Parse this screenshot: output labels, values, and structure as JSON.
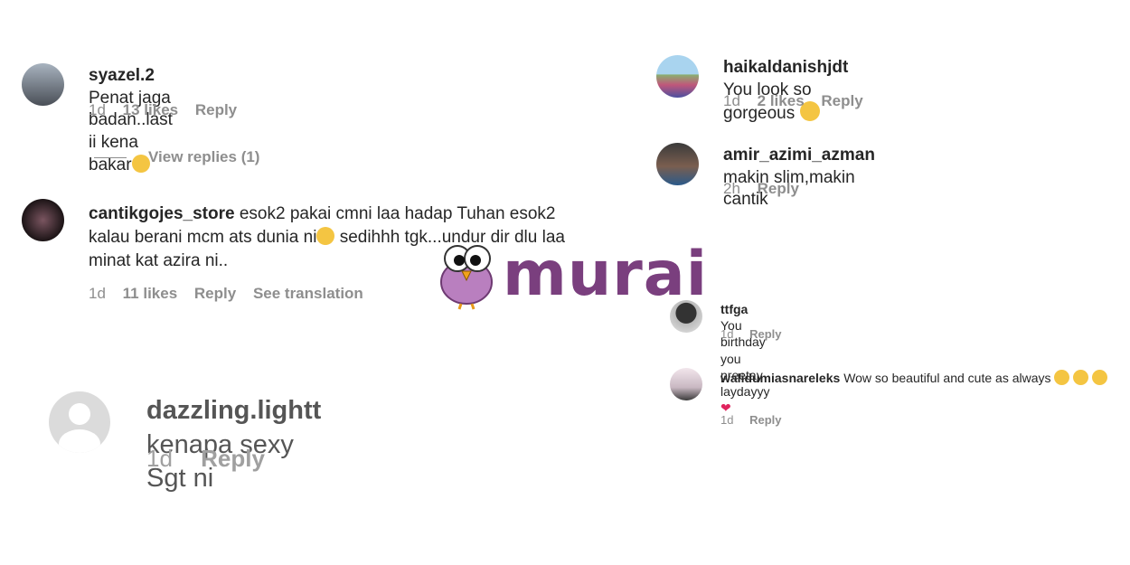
{
  "comments": [
    {
      "user": "syazel.2",
      "text": "Penat jaga badan..last ii kena bakar",
      "emoji": "sad-face-icon",
      "time": "1d",
      "likes": "13 likes",
      "reply": "Reply",
      "view_replies": "View replies (1)"
    },
    {
      "user": "cantikgojes_store",
      "text": "esok2 pakai cmni laa hadap Tuhan esok2 kalau berani mcm ats dunia ni",
      "text2": "sedihhh tgk...undur dir dlu laa minat kat azira ni..",
      "emoji": "sad-face-icon",
      "time": "1d",
      "likes": "11 likes",
      "reply": "Reply",
      "translate": "See translation"
    },
    {
      "user": "dazzling.lightt",
      "text": "kenapa sexy Sgt ni",
      "time": "1d",
      "reply": "Reply"
    },
    {
      "user": "haikaldanishjdt",
      "text": "You look so gorgeous",
      "emoji": "heart-eyes-icon",
      "time": "1d",
      "likes": "2 likes",
      "reply": "Reply"
    },
    {
      "user": "amir_azimi_azman",
      "text": "makin slim,makin cantik",
      "time": "2h",
      "reply": "Reply"
    },
    {
      "user": "ttfga",
      "text": "You birthday you preetay laydayyy",
      "emoji": "red-heart-icon",
      "time": "1d",
      "reply": "Reply"
    },
    {
      "user": "walidumiasnareleks",
      "text": "Wow so beautiful and cute as always",
      "emoji": "smiling-hearts-icon",
      "time": "1d",
      "reply": "Reply"
    }
  ],
  "watermark": {
    "text": "murai",
    "icon": "bird-logo-icon",
    "color": "#7a3f7e"
  }
}
